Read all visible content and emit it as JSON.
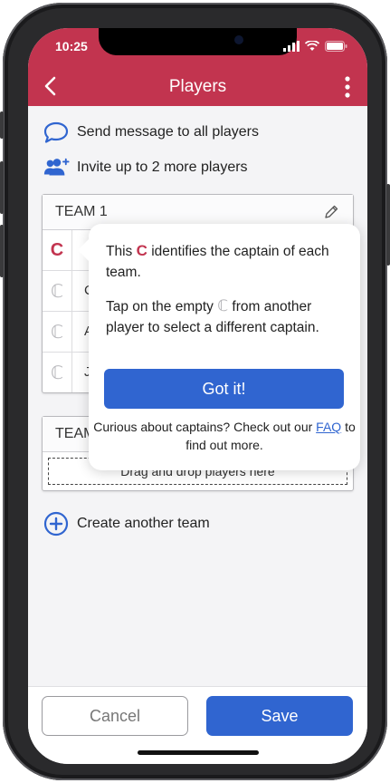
{
  "status": {
    "time": "10:25"
  },
  "nav": {
    "title": "Players"
  },
  "actions": {
    "message": "Send message to all players",
    "invite": "Invite up to 2 more players"
  },
  "team1": {
    "title": "TEAM 1",
    "players": [
      {
        "cap": "C",
        "initial": ""
      },
      {
        "cap": "ℂ",
        "initial": "C"
      },
      {
        "cap": "ℂ",
        "initial": "A"
      },
      {
        "cap": "ℂ",
        "initial": "J"
      }
    ]
  },
  "team2": {
    "title": "TEAM",
    "dropzone": "Drag and drop players here"
  },
  "create_team": "Create another team",
  "popover": {
    "line1_a": "This",
    "line1_c": "C",
    "line1_b": "identifies the captain of each team.",
    "line2_a": "Tap on the empty",
    "line2_c": "ℂ",
    "line2_b": "from another player to select a different captain.",
    "button": "Got it!",
    "foot_a": "Curious about captains? Check out our",
    "foot_link": "FAQ",
    "foot_b": "to find out more."
  },
  "bottom": {
    "cancel": "Cancel",
    "save": "Save"
  },
  "colors": {
    "brand": "#c2344f",
    "primary": "#3065d0"
  }
}
